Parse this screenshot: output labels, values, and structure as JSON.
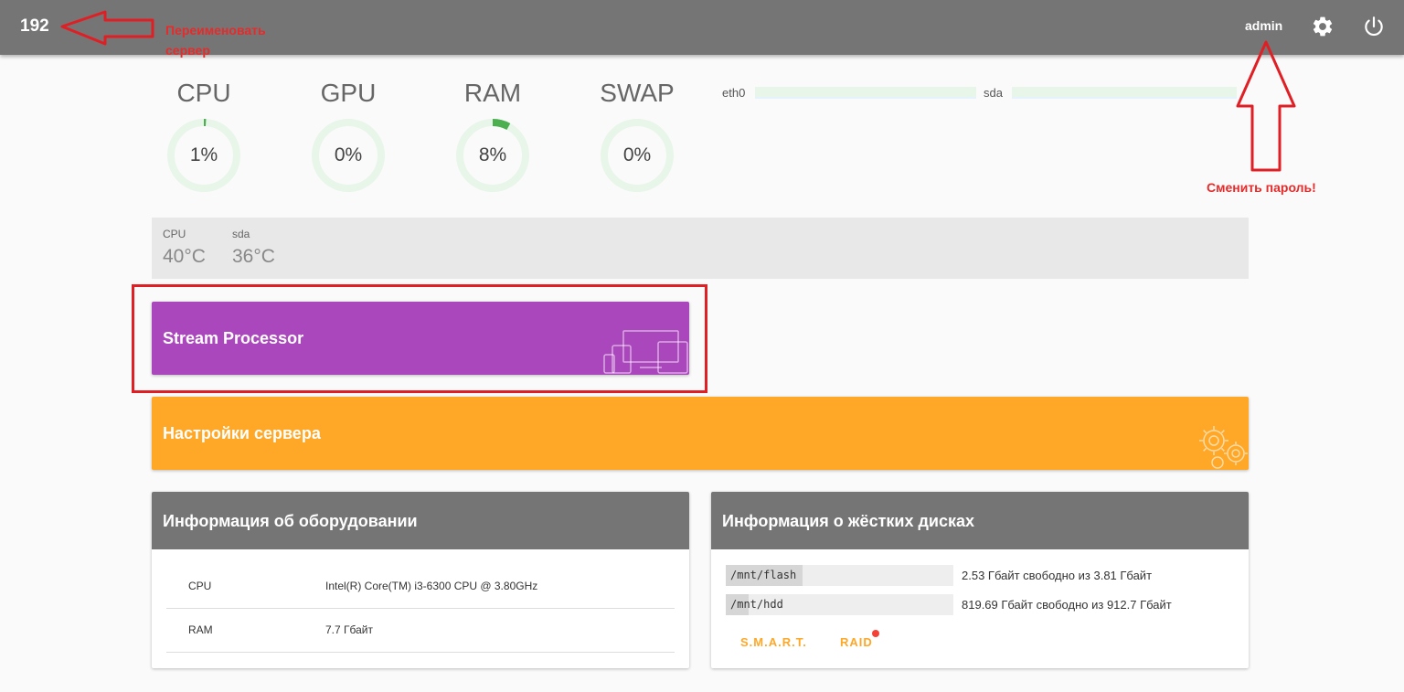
{
  "header": {
    "server_name": "192",
    "user": "admin",
    "icons": {
      "settings": "gear-icon",
      "logout": "power-icon"
    }
  },
  "gauges": [
    {
      "label": "CPU",
      "value_text": "1%",
      "percent": 1,
      "color": "#4caf50"
    },
    {
      "label": "GPU",
      "value_text": "0%",
      "percent": 0,
      "color": "#4caf50"
    },
    {
      "label": "RAM",
      "value_text": "8%",
      "percent": 8,
      "color": "#4caf50"
    },
    {
      "label": "SWAP",
      "value_text": "0%",
      "percent": 0,
      "color": "#4caf50"
    }
  ],
  "io": [
    {
      "label": "eth0"
    },
    {
      "label": "sda"
    }
  ],
  "temperatures": [
    {
      "label": "CPU",
      "value": "40°C"
    },
    {
      "label": "sda",
      "value": "36°C"
    }
  ],
  "tiles": {
    "stream": {
      "title": "Stream Processor",
      "color": "#ab47bc",
      "icon": "devices-icon"
    },
    "settings": {
      "title": "Настройки сервера",
      "color": "#ffa726",
      "icon": "gears-icon"
    }
  },
  "hardware": {
    "title": "Информация об оборудовании",
    "rows": [
      {
        "key": "CPU",
        "value": "Intel(R) Core(TM) i3-6300 CPU @ 3.80GHz"
      },
      {
        "key": "RAM",
        "value": "7.7 Гбайт"
      }
    ]
  },
  "disks": {
    "title": "Информация о жёстких дисках",
    "items": [
      {
        "path": "/mnt/flash",
        "info": "2.53 Гбайт свободно из 3.81 Гбайт",
        "used_fraction": 0.336
      },
      {
        "path": "/mnt/hdd",
        "info": "819.69 Гбайт свободно из 912.7 Гбайт",
        "used_fraction": 0.102
      }
    ],
    "links": {
      "smart": "S.M.A.R.T.",
      "raid": "RAID"
    }
  },
  "annotations": {
    "rename": "Переименовать\nсервер",
    "change_password": "Сменить пароль!",
    "color": "#e52b2b"
  }
}
